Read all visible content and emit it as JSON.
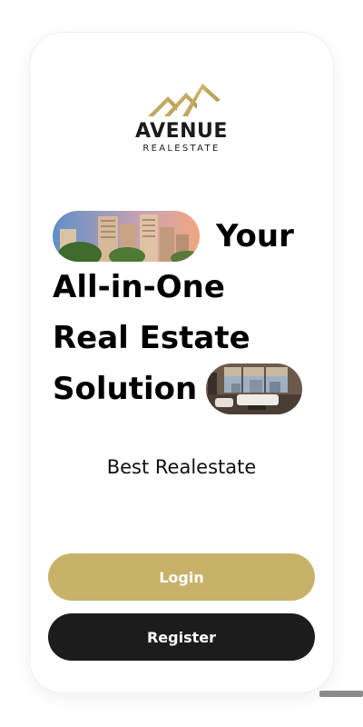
{
  "brand": {
    "name": "AVENUE",
    "subtitle": "REALESTATE",
    "logo_icon": "house-roofs-logo"
  },
  "hero": {
    "line1": "Your",
    "line2": "All-in-One",
    "line3": "Real Estate",
    "line4": "Solution",
    "image_city": "city-apartments-image",
    "image_interior": "living-room-image"
  },
  "tagline": "Best Realestate",
  "actions": {
    "login_label": "Login",
    "register_label": "Register"
  },
  "colors": {
    "accent_gold": "#c8b269",
    "dark": "#1c1c1c"
  }
}
